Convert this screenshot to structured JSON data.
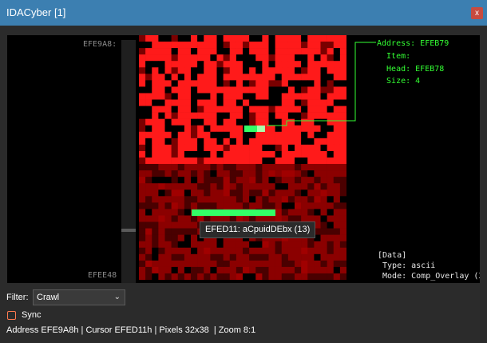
{
  "window": {
    "title": "IDACyber [1]",
    "close_glyph": "x"
  },
  "viewer": {
    "start_address": "EFE9A8:",
    "end_address": "EFEE48"
  },
  "hint": {
    "lines": [
      "Address: EFEB79",
      "  Item:",
      "  Head: EFEB78",
      "  Size: 4"
    ]
  },
  "data_panel": {
    "lines": [
      "[Data]",
      " Type: ascii",
      " Mode: Comp_Overlay (3"
    ]
  },
  "tooltip": {
    "text": "EFED11: aCpuidDEbx (13)"
  },
  "filter": {
    "label": "Filter:",
    "value": "Crawl"
  },
  "sync": {
    "label": "Sync",
    "checked": false
  },
  "status": {
    "text": "Address EFE9A8h | Cursor EFED11h | Pixels 32x38  | Zoom 8:1"
  },
  "colors": {
    "code_red": "#ff1a1a",
    "code_dark": "#7a0000",
    "data_red": "#8b0000",
    "data_dark": "#4a0000",
    "highlight": "#33ff66",
    "highlight_alt": "#aaffaa",
    "hint_green": "#33ff33",
    "titlebar": "#3c7fb1"
  }
}
